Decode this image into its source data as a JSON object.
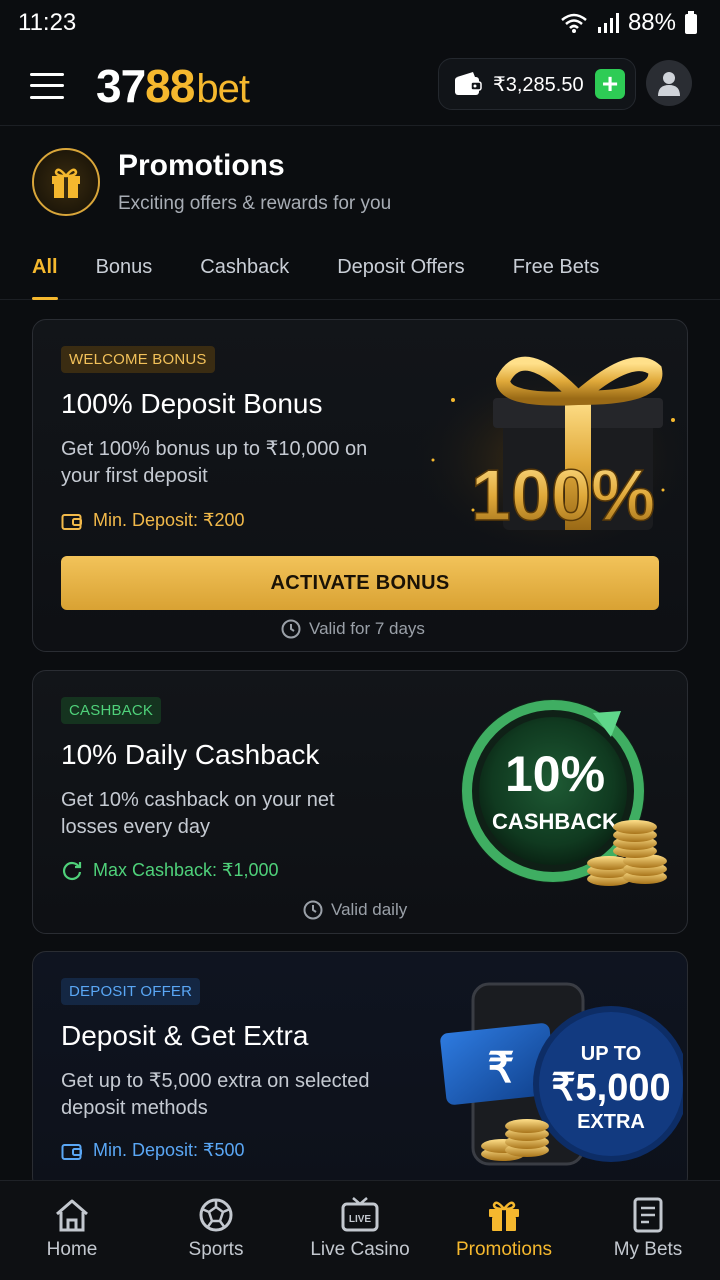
{
  "status_bar": {
    "time": "11:23",
    "battery": "88%"
  },
  "header": {
    "logo_number_white": "37",
    "logo_number_yellow": "88",
    "logo_suffix": "bet",
    "wallet_balance": "₹3,285.50",
    "add_funds_label": "+"
  },
  "page": {
    "title": "Promotions",
    "subtitle": "Exciting offers & rewards for you"
  },
  "tabs": [
    {
      "label": "All",
      "active": true
    },
    {
      "label": "Bonus",
      "active": false
    },
    {
      "label": "Cashback",
      "active": false
    },
    {
      "label": "Deposit Offers",
      "active": false
    },
    {
      "label": "Free Bets",
      "active": false
    }
  ],
  "promos": [
    {
      "badge": "WELCOME BONUS",
      "title": "100% Deposit Bonus",
      "description": "Get 100% bonus up to ₹10,000 on your first deposit",
      "meta": "Min. Deposit: ₹200",
      "button": "ACTIVATE BONUS",
      "validity": "Valid for 7 days",
      "art_text": "100%"
    },
    {
      "badge": "CASHBACK",
      "title": "10% Daily Cashback",
      "description": "Get 10% cashback on your net losses every day",
      "meta": "Max Cashback: ₹1,000",
      "validity": "Valid daily",
      "art_text": "10%",
      "art_subtext": "CASHBACK"
    },
    {
      "badge": "DEPOSIT OFFER",
      "title": "Deposit & Get Extra",
      "description": "Get up to ₹5,000 extra on selected deposit methods",
      "meta": "Min. Deposit: ₹500",
      "art_line1": "UP TO",
      "art_line2": "₹5,000",
      "art_line3": "EXTRA",
      "art_card_symbol": "₹"
    }
  ],
  "bottom_nav": [
    {
      "label": "Home",
      "icon": "home-icon",
      "active": false
    },
    {
      "label": "Sports",
      "icon": "soccer-ball-icon",
      "active": false
    },
    {
      "label": "Live Casino",
      "icon": "live-tv-icon",
      "active": false
    },
    {
      "label": "Promotions",
      "icon": "gift-icon",
      "active": true
    },
    {
      "label": "My Bets",
      "icon": "bet-slip-icon",
      "active": false
    }
  ],
  "colors": {
    "accent": "#f5b82e",
    "green": "#4fd17a",
    "blue": "#5aa7f5",
    "background": "#0b0d10"
  }
}
